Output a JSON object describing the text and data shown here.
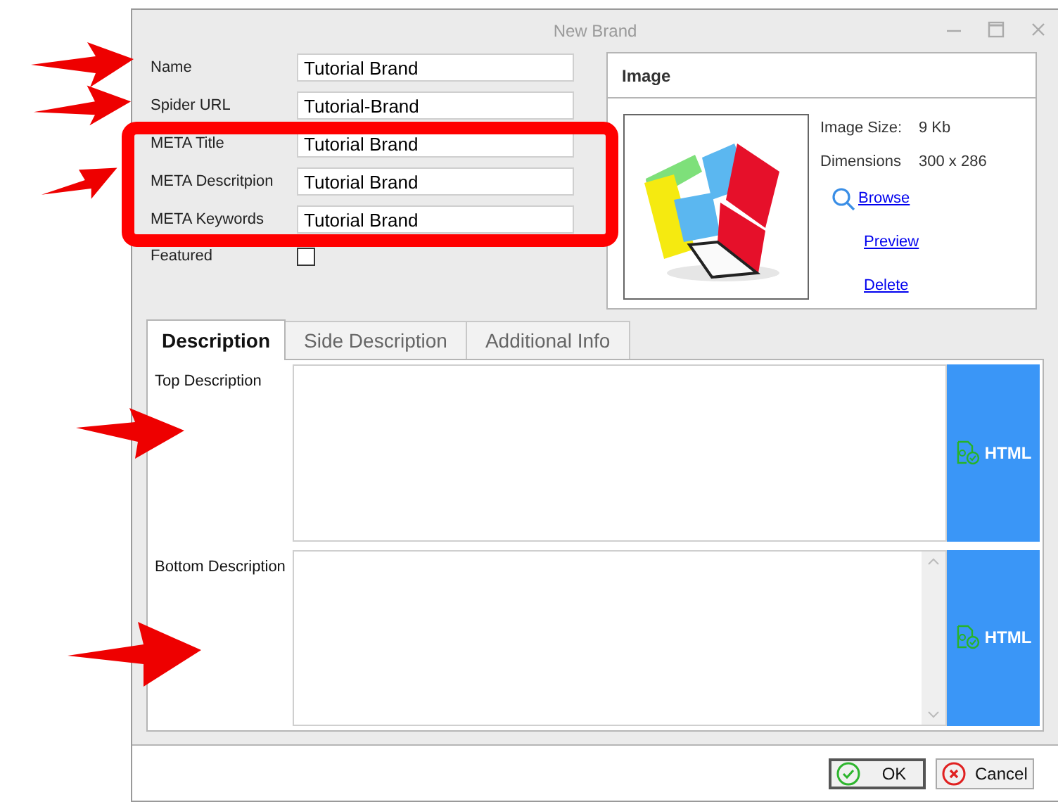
{
  "window": {
    "title": "New Brand"
  },
  "fields": [
    {
      "label": "Name",
      "value": "Tutorial Brand"
    },
    {
      "label": "Spider URL",
      "value": "Tutorial-Brand"
    },
    {
      "label": "META Title",
      "value": "Tutorial Brand"
    },
    {
      "label": "META Descritpion",
      "value": "Tutorial Brand"
    },
    {
      "label": "META Keywords",
      "value": "Tutorial Brand"
    }
  ],
  "featured": {
    "label": "Featured",
    "checked": false
  },
  "image_panel": {
    "title": "Image",
    "info": [
      {
        "label": "Image Size:",
        "value": "9 Kb"
      },
      {
        "label": "Dimensions",
        "value": "300 x 286"
      }
    ],
    "links": [
      {
        "label": "Browse",
        "kind": "search"
      },
      {
        "label": "Preview",
        "kind": "plain"
      },
      {
        "label": "Delete",
        "kind": "plain"
      }
    ]
  },
  "tabs": [
    {
      "label": "Description",
      "selected": true
    },
    {
      "label": "Side Description",
      "selected": false
    },
    {
      "label": "Additional Info",
      "selected": false
    }
  ],
  "editors": [
    {
      "label": "Top Description",
      "button": "HTML",
      "scrollbar": false
    },
    {
      "label": "Bottom Description",
      "button": "HTML",
      "scrollbar": true
    }
  ],
  "buttons": [
    {
      "label": "OK",
      "kind": "ok",
      "default": true
    },
    {
      "label": "Cancel",
      "kind": "cancel",
      "default": false
    }
  ]
}
